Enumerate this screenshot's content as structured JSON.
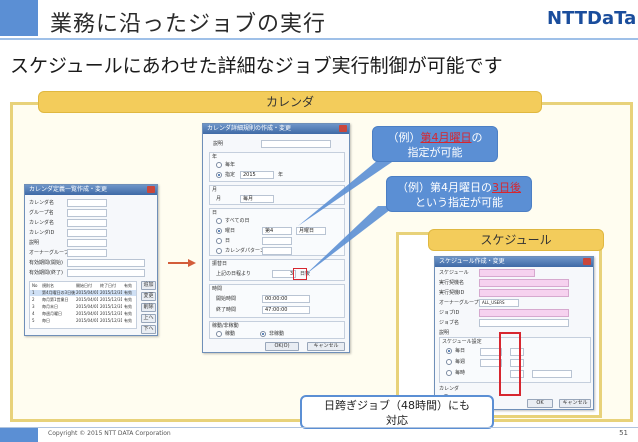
{
  "header": {
    "title": "業務に沿ったジョブの実行",
    "logo": "NTTDaTa"
  },
  "subtitle": "スケジュールにあわせた詳細なジョブ実行制御が可能です",
  "calendar_banner": "カレンダ",
  "schedule_banner": "スケジュール",
  "callouts": {
    "c1_prefix": "（例）",
    "c1_highlight": "第4月曜日",
    "c1_suffix": "の",
    "c1_line2": "指定が可能",
    "c2_prefix": "（例）第4月曜日の",
    "c2_highlight": "3日後",
    "c2_line2": "という指定が可能",
    "c3_line1": "日跨ぎジョブ（48時間）にも",
    "c3_line2": "対応"
  },
  "left_window": {
    "title": "カレンダ定義一覧作成・変更",
    "fields": [
      "カレンダ名",
      "グループ名",
      "カレンダ名",
      "カレンダID",
      "説明",
      "オーナーグループ",
      "有効期間(開始)",
      "有効期間(終了)"
    ],
    "table_header": [
      "No",
      "規則名",
      "開始日付",
      "終了日付",
      "有効"
    ],
    "table_rows": [
      [
        "1",
        "第4月曜日の3日後",
        "2015/04/01",
        "2015/12/31",
        "有効"
      ],
      [
        "2",
        "毎月第1営業日",
        "2015/04/01",
        "2015/12/31",
        "有効"
      ],
      [
        "3",
        "毎月末日",
        "2015/04/01",
        "2015/12/31",
        "有効"
      ],
      [
        "4",
        "毎週月曜日",
        "2015/04/01",
        "2015/12/31",
        "有効"
      ],
      [
        "5",
        "毎日",
        "2015/04/01",
        "2015/12/31",
        "有効"
      ]
    ],
    "side_buttons": [
      "追加",
      "変更",
      "削除",
      "上へ",
      "下へ"
    ]
  },
  "middle_window": {
    "title": "カレンダ詳細規則の作成・変更",
    "desc_label": "説明",
    "year_group": "年",
    "year_every": "毎年",
    "year_specified": "指定",
    "year_value": "2015",
    "year_unit": "年",
    "month_group": "月",
    "month_label": "月",
    "month_value": "毎月",
    "day_group": "日",
    "day_all": "すべての日",
    "day_weekday": "曜日",
    "day_week_value": "第4",
    "day_weekday_value": "月曜日",
    "day_day": "日",
    "day_calendar_pattern": "カレンダパターン",
    "offset_group": "振替日",
    "offset_label": "上記の日程より",
    "offset_value": "3",
    "offset_unit": "日後",
    "time_group": "時間",
    "start_time_label": "開始時間",
    "start_time_value": "00:00:00",
    "end_time_label": "終了時間",
    "end_time_value": "47:00:00",
    "operation_group": "稼動/非稼動",
    "operation_on": "稼動",
    "operation_off": "非稼動",
    "ok_label": "OK(O)",
    "cancel_label": "キャンセル"
  },
  "right_window": {
    "title": "スケジュール作成・変更",
    "fields": [
      "スケジュール",
      "実行契機名",
      "実行契機ID",
      "オーナーグループ",
      "ジョブID",
      "ジョブ名",
      "説明"
    ],
    "owner_value": "ALL_USERS",
    "schedule_group": "スケジュール設定",
    "sched_opt1": "毎日",
    "sched_opt2": "毎週",
    "sched_opt3": "毎時",
    "calendar_label": "カレンダ",
    "ok_label": "OK",
    "cancel_label": "キャンセル"
  },
  "footer": {
    "copyright": "Copyright © 2015 NTT DATA Corporation",
    "page": "51"
  },
  "colors": {
    "accent_blue": "#5b8fd4",
    "banner_yellow": "#f3cc5b",
    "highlight_red": "#d7262f",
    "logo_blue": "#1a4d9c"
  }
}
